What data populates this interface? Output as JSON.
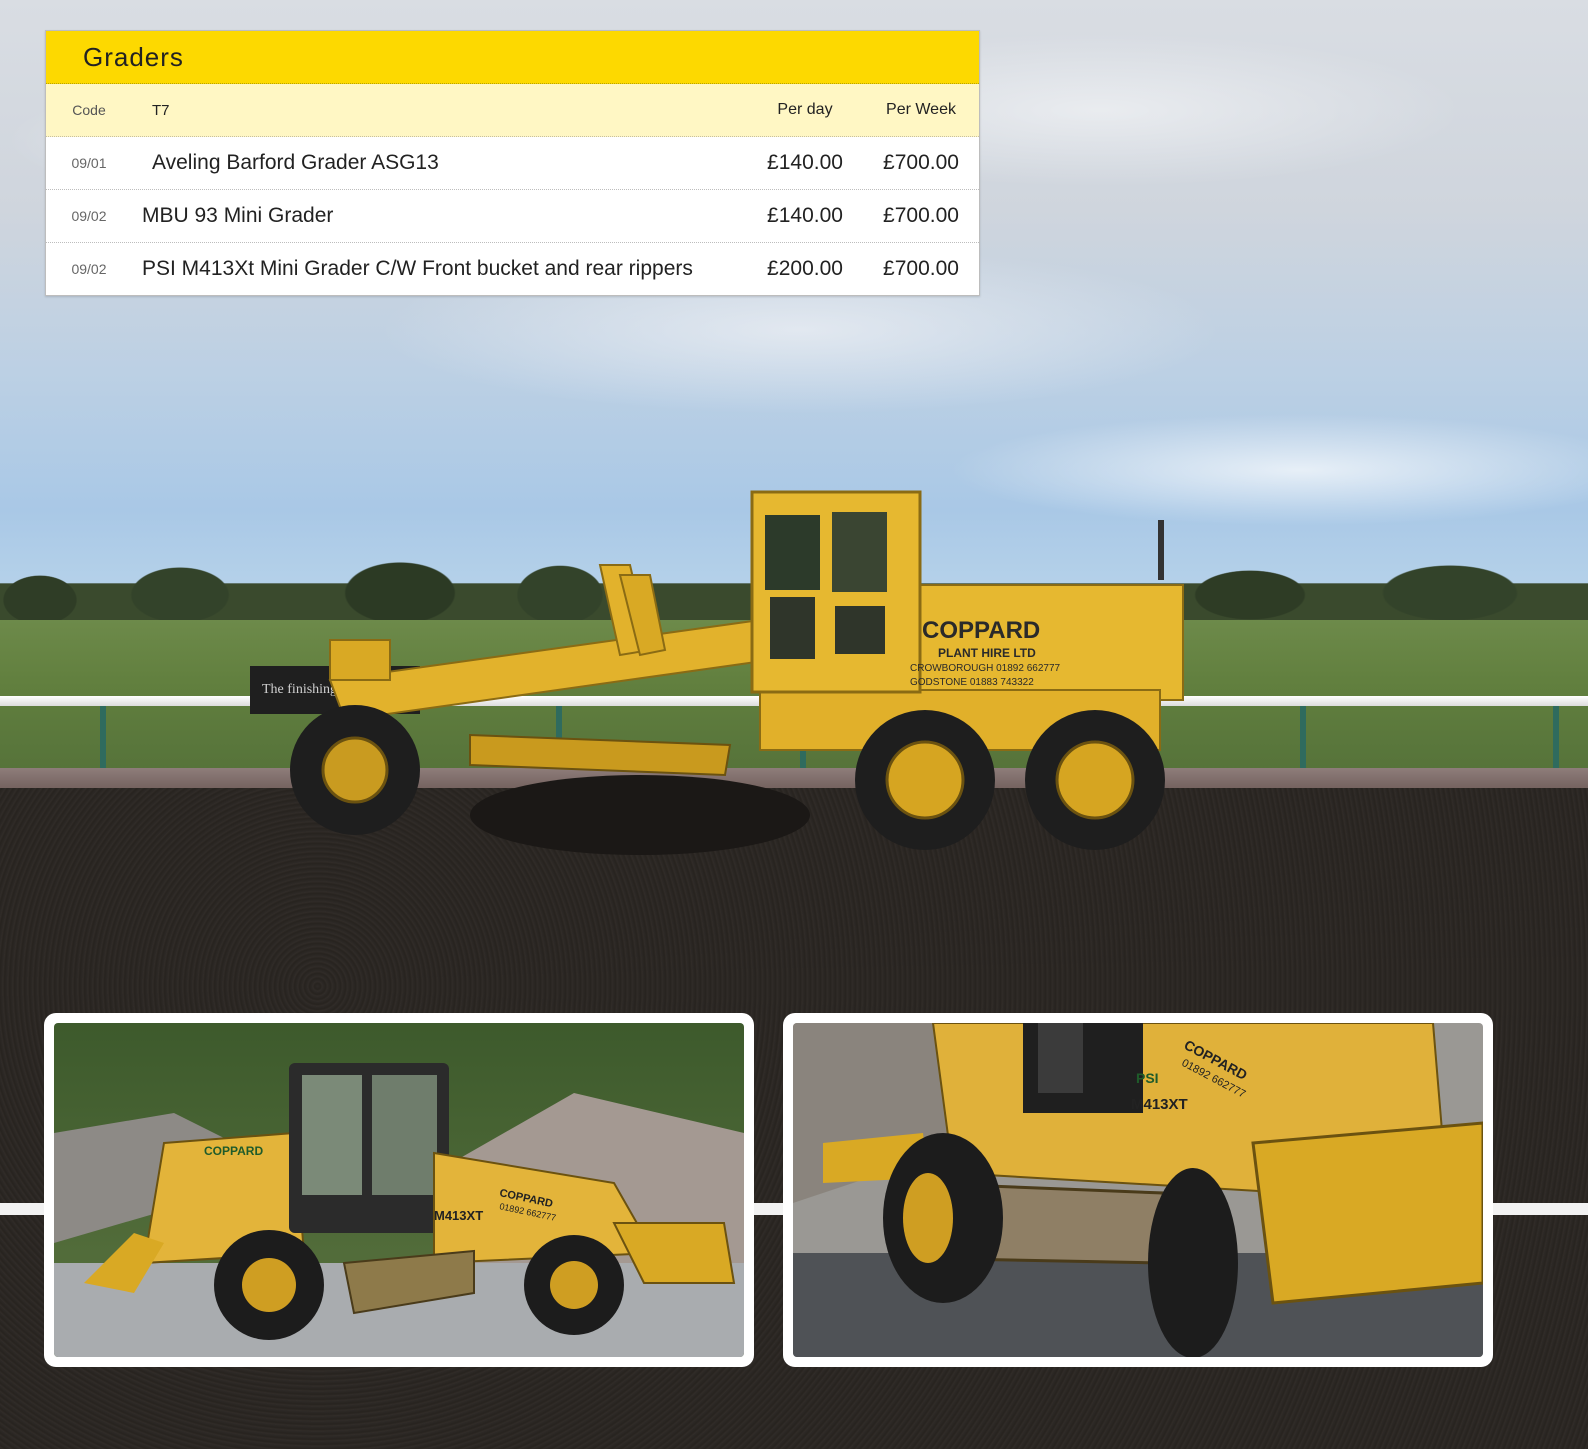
{
  "table": {
    "title": "Graders",
    "header": {
      "code": "Code",
      "category": "T7",
      "per_day": "Per day",
      "per_week": "Per Week"
    },
    "rows": [
      {
        "code": "09/01",
        "description": "Aveling Barford Grader ASG13",
        "per_day": "£140.00",
        "per_week": "£700.00"
      },
      {
        "code": "09/02",
        "description": "MBU 93 Mini Grader",
        "per_day": "£140.00",
        "per_week": "£700.00"
      },
      {
        "code": "09/02",
        "description": "PSI M413Xt Mini Grader C/W Front bucket and rear rippers",
        "per_day": "£200.00",
        "per_week": "£700.00"
      }
    ]
  },
  "grader_livery": {
    "brand": "COPPARD",
    "line1": "PLANT HIRE LTD",
    "line2": "CROWBOROUGH 01892 662777",
    "line3": "GODSTONE   01883 743322"
  },
  "banner_text": "The finishing",
  "mini_grader_left": {
    "brand": "COPPARD",
    "model": "M413XT",
    "decal_brand": "COPPARD",
    "decal_phone": "01892 662777"
  },
  "mini_grader_right": {
    "logo": "PSI",
    "model": "M413XT",
    "decal_brand": "COPPARD",
    "decal_phone": "01892 662777"
  },
  "colors": {
    "header_yellow": "#fdd900",
    "subheader_cream": "#fff7c4",
    "machine_yellow": "#e6b830",
    "text_dark": "#222222"
  }
}
